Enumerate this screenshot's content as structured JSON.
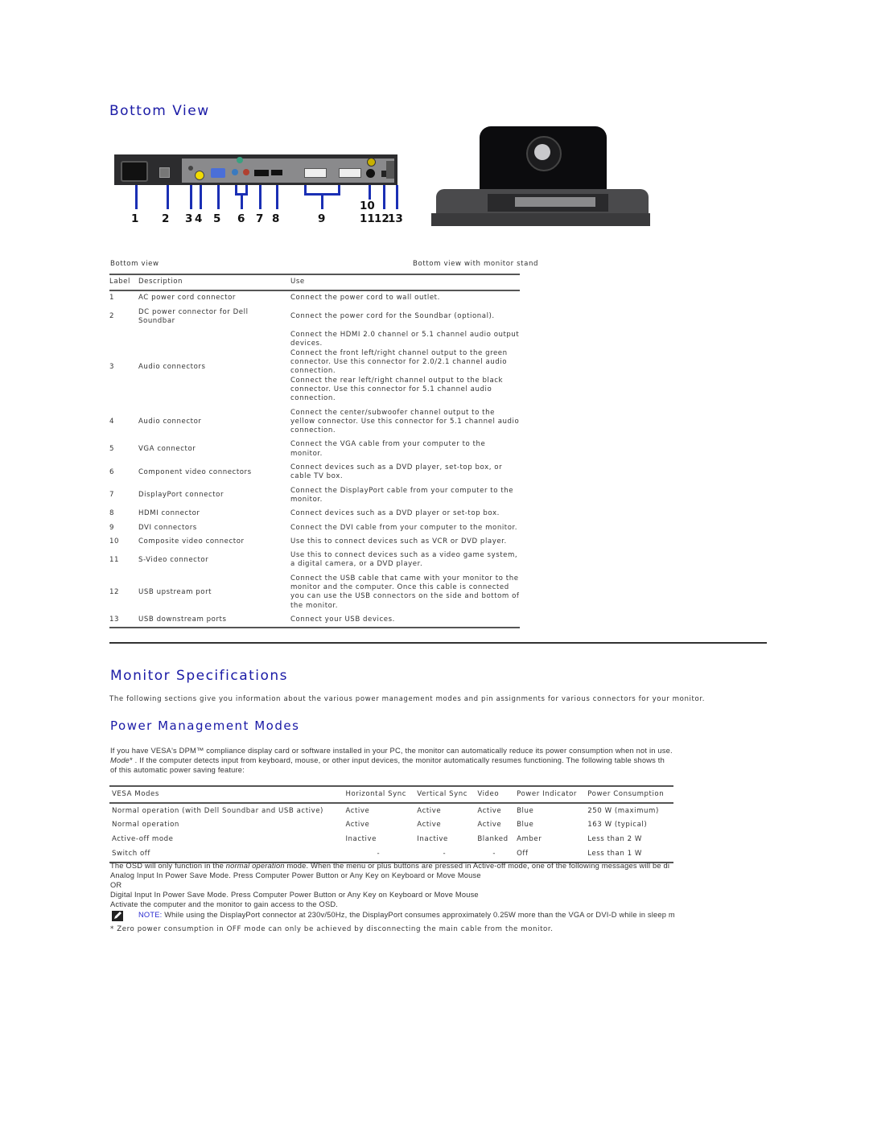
{
  "bottom_view": {
    "title": "Bottom View",
    "callouts": [
      "1",
      "2",
      "3",
      "4",
      "5",
      "6",
      "7",
      "8",
      "9",
      "10",
      "11",
      "12",
      "13"
    ],
    "caption_left": "Bottom view",
    "caption_right": "Bottom view with monitor stand",
    "table": {
      "headers": {
        "label": "Label",
        "description": "Description",
        "use": "Use"
      },
      "rows": [
        {
          "label": "1",
          "description": "AC power cord connector",
          "use": [
            "Connect the power cord to wall outlet."
          ]
        },
        {
          "label": "2",
          "description": "DC power connector for Dell Soundbar",
          "use": [
            "Connect the power cord for the Soundbar (optional)."
          ]
        },
        {
          "label": "3",
          "description": "Audio connectors",
          "use": [
            "Connect the HDMI 2.0 channel or 5.1 channel audio output devices.",
            "Connect the front left/right channel output to the green connector.  Use this connector for 2.0/2.1 channel audio connection.",
            "Connect the rear left/right channel output to the black connector. Use this connector for 5.1 channel audio connection."
          ]
        },
        {
          "label": "4",
          "description": "Audio connector",
          "use": [
            "Connect the center/subwoofer channel output to the yellow connector.  Use this connector for 5.1 channel audio connection."
          ]
        },
        {
          "label": "5",
          "description": "VGA connector",
          "use": [
            "Connect the VGA cable from your computer to the monitor."
          ]
        },
        {
          "label": "6",
          "description": "Component video connectors",
          "use": [
            "Connect devices such as a DVD player, set-top box, or cable TV box."
          ]
        },
        {
          "label": "7",
          "description": "DisplayPort connector",
          "use": [
            "Connect the DisplayPort cable from your computer to the monitor."
          ]
        },
        {
          "label": "8",
          "description": "HDMI connector",
          "use": [
            "Connect devices such as a DVD player or set-top box."
          ]
        },
        {
          "label": "9",
          "description": "DVI connectors",
          "use": [
            "Connect the DVI cable from your computer to the monitor."
          ]
        },
        {
          "label": "10",
          "description": "Composite video connector",
          "use": [
            "Use this to connect devices such as VCR or DVD player."
          ]
        },
        {
          "label": "11",
          "description": "S-Video connector",
          "use": [
            "Use this to connect devices such as a video game system, a digital camera, or a DVD player."
          ]
        },
        {
          "label": "12",
          "description": "USB upstream port",
          "use": [
            "Connect the USB cable that came with your monitor to the monitor and the computer. Once this cable is connected you can use the USB connectors on the side and bottom of the monitor."
          ]
        },
        {
          "label": "13",
          "description": "USB downstream ports",
          "use": [
            "Connect your USB devices."
          ]
        }
      ]
    }
  },
  "monitor_specs": {
    "title": "Monitor Specifications",
    "intro": "The following sections give you information about the various power management modes and pin assignments for various connectors for your monitor."
  },
  "power_management": {
    "title": "Power Management Modes",
    "para_line1": "If you have VESA's DPM™ compliance display card or software installed in your PC, the monitor can automatically reduce its power consumption when not in use.",
    "para_line2_italic": "Mode",
    "para_line2_rest": "* . If the computer detects input from keyboard, mouse, or other input devices, the monitor automatically resumes functioning. The following table shows th",
    "para_line3": "of this automatic power saving feature:",
    "table": {
      "headers": [
        "VESA Modes",
        "Horizontal Sync",
        "Vertical Sync",
        "Video",
        "Power Indicator",
        "Power Consumption"
      ],
      "rows": [
        [
          "Normal operation (with Dell Soundbar and USB active)",
          "Active",
          "Active",
          "Active",
          "Blue",
          "250 W (maximum)"
        ],
        [
          "Normal operation",
          "Active",
          "Active",
          "Active",
          "Blue",
          "163 W (typical)"
        ],
        [
          "Active-off mode",
          "Inactive",
          "Inactive",
          "Blanked",
          "Amber",
          "Less than 2 W"
        ],
        [
          "Switch off",
          "-",
          "-",
          "-",
          "Off",
          "Less than 1 W"
        ]
      ]
    },
    "osd_line_prefix": "The OSD will only function in the ",
    "osd_line_italic": "normal operation",
    "osd_line_suffix": " mode. When the menu or plus buttons are pressed in Active-off mode, one of the following messages will be di",
    "msg_analog": "Analog Input In Power Save Mode. Press Computer Power Button or Any Key on Keyboard or Move Mouse",
    "msg_or": "OR",
    "msg_digital": "Digital Input In Power Save Mode. Press Computer Power Button or Any Key on Keyboard or Move Mouse",
    "msg_activate": "Activate the computer and the monitor to gain access to the OSD.",
    "note_label": "NOTE:",
    "note_text": " While using the DisplayPort connector at 230v/50Hz, the DisplayPort consumes  approximately 0.25W more than the VGA or DVI-D while in sleep m",
    "footnote": "*  Zero power consumption in OFF mode can only be achieved by disconnecting the main cable from the monitor."
  },
  "colors": {
    "heading_blue": "#1a1aa6",
    "callout_blue": "#1a2fb4",
    "note_blue": "#2a2ad0"
  }
}
